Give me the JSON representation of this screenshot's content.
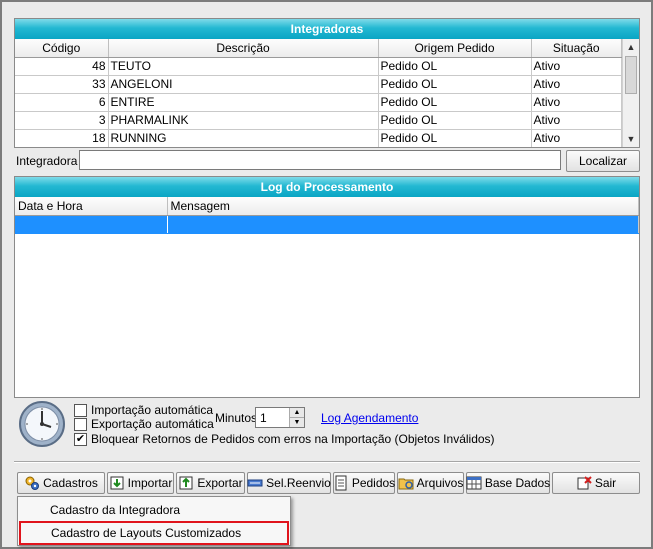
{
  "integradoras": {
    "title": "Integradoras",
    "columns": [
      "Código",
      "Descrição",
      "Origem Pedido",
      "Situação"
    ],
    "rows": [
      {
        "codigo": "48",
        "descricao": "TEUTO",
        "origem": "Pedido OL",
        "situacao": "Ativo"
      },
      {
        "codigo": "33",
        "descricao": "ANGELONI",
        "origem": "Pedido OL",
        "situacao": "Ativo"
      },
      {
        "codigo": "6",
        "descricao": "ENTIRE",
        "origem": "Pedido OL",
        "situacao": "Ativo"
      },
      {
        "codigo": "3",
        "descricao": "PHARMALINK",
        "origem": "Pedido OL",
        "situacao": "Ativo"
      },
      {
        "codigo": "18",
        "descricao": "RUNNING",
        "origem": "Pedido OL",
        "situacao": "Ativo"
      }
    ]
  },
  "search": {
    "label": "Integradora",
    "value": "",
    "button": "Localizar"
  },
  "log": {
    "title": "Log do Processamento",
    "columns": [
      "Data e Hora",
      "Mensagem"
    ]
  },
  "options": {
    "import_auto": "Importação automática",
    "export_auto": "Exportação automática",
    "block_returns": "Bloquear Retornos de Pedidos com erros na Importação (Objetos Inválidos)",
    "minutes_label": "Minutos",
    "minutes_value": "1",
    "log_link": "Log Agendamento",
    "import_auto_checked": false,
    "export_auto_checked": false,
    "block_returns_checked": true
  },
  "toolbar": {
    "cadastros": "Cadastros",
    "importar": "Importar",
    "exportar": "Exportar",
    "reenvio": "Sel.Reenvio",
    "pedidos": "Pedidos",
    "arquivos": "Arquivos",
    "base": "Base Dados",
    "sair": "Sair"
  },
  "menu": {
    "item1": "Cadastro da Integradora",
    "item2": "Cadastro de Layouts Customizados"
  },
  "colors": {
    "header_accent": "#0aa5c4",
    "selection": "#1e90ff",
    "highlight_border": "#e0141c",
    "link": "#0000ee"
  }
}
